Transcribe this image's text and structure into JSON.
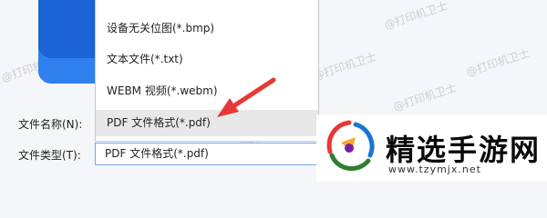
{
  "watermarks": [
    "@打印机卫士",
    "@打印机卫士",
    "@打印机卫士",
    "@打印机卫士",
    "@打印机卫士",
    "@打印机卫士",
    "@打印机卫士",
    "@打印机卫士"
  ],
  "dropdown": {
    "items": [
      {
        "label": "设备无关位图(*.bmp)",
        "selected": false
      },
      {
        "label": "文本文件(*.txt)",
        "selected": false
      },
      {
        "label": "WEBM 视频(*.webm)",
        "selected": false
      },
      {
        "label": "PDF 文件格式(*.pdf)",
        "selected": true
      }
    ]
  },
  "form": {
    "filename_label": "文件名称(N):",
    "filetype_label": "文件类型(T):",
    "filetype_value": "PDF 文件格式(*.pdf)"
  },
  "logo": {
    "title": "精选手游网",
    "url": "www.tzymjx.net"
  },
  "colors": {
    "arrow": "#e53935",
    "selected_bg": "#e8e8e8",
    "file_icon": "#1c63d6"
  }
}
